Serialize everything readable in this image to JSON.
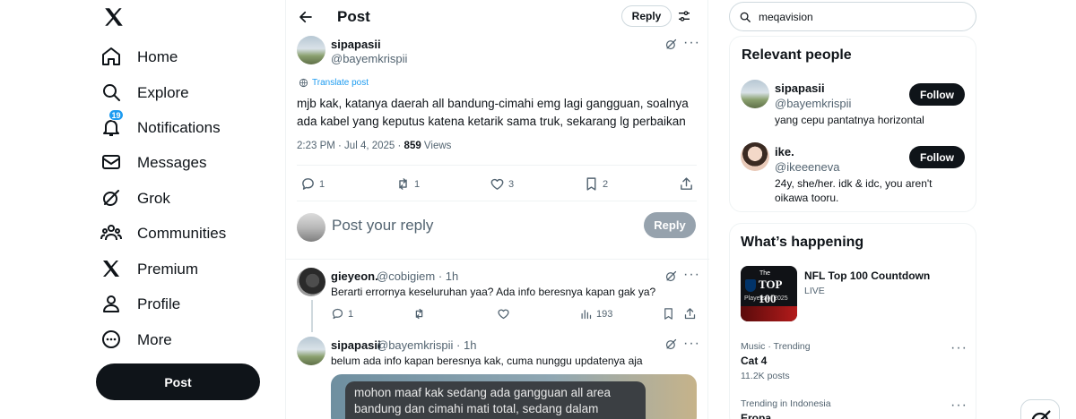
{
  "colors": {
    "accent": "#1d9bf0",
    "text": "#0f1419",
    "muted": "#536471",
    "dark_button": "#0f1419"
  },
  "nav": {
    "logo_icon": "x-logo-icon",
    "items": [
      {
        "label": "Home",
        "icon": "home-icon"
      },
      {
        "label": "Explore",
        "icon": "search-icon"
      },
      {
        "label": "Notifications",
        "icon": "bell-icon",
        "badge": "19"
      },
      {
        "label": "Messages",
        "icon": "envelope-icon"
      },
      {
        "label": "Grok",
        "icon": "grok-icon"
      },
      {
        "label": "Communities",
        "icon": "people-icon"
      },
      {
        "label": "Premium",
        "icon": "x-logo-icon"
      },
      {
        "label": "Profile",
        "icon": "person-icon"
      },
      {
        "label": "More",
        "icon": "more-circle-icon"
      }
    ],
    "post_button": "Post"
  },
  "header": {
    "title": "Post",
    "reply_pill": "Reply"
  },
  "tweet": {
    "name": "sipapasii",
    "handle": "@bayemkrispii",
    "translate": "Translate post",
    "text": "mjb kak, katanya daerah all bandung-cimahi emg lagi gangguan, soalnya ada kabel yang keputus katena ketarik sama truk, sekarang lg perbaikan",
    "time": "2:23 PM · Jul 4, 2025 · ",
    "views": "859",
    "views_label": " Views",
    "replies": "1",
    "reposts": "1",
    "likes": "3",
    "bookmarks": "2"
  },
  "compose": {
    "placeholder": "Post your reply",
    "button": "Reply"
  },
  "replies": [
    {
      "name": "gieyeon.",
      "handle": "@cobigiem · 1h",
      "text": "Berarti errornya keseluruhan yaa? Ada info beresnya kapan gak ya?",
      "replies": "1",
      "views": "193"
    },
    {
      "name": "sipapasii",
      "handle": "@bayemkrispii · 1h",
      "text": "belum ada info kapan beresnya kak, cuma nunggu updatenya aja",
      "media_text": "mohon maaf kak sedang ada gangguan all area bandung dan cimahi mati total, sedang dalam"
    }
  ],
  "sidebar": {
    "search_value": "meqavision",
    "relevant_title": "Relevant people",
    "people": [
      {
        "name": "sipapasii",
        "handle": "@bayemkrispii",
        "bio": "yang cepu pantatnya horizontal",
        "follow": "Follow"
      },
      {
        "name": "ike.",
        "handle": "@ikeeeneva",
        "bio": "24y, she/her. idk & idc, you aren't oikawa tooru.",
        "follow": "Follow"
      }
    ],
    "happening_title": "What’s happening",
    "featured": {
      "title": "NFL Top 100 Countdown",
      "status": "LIVE",
      "thumb_top": "TOP 100",
      "thumb_the": "The",
      "thumb_players": "Players of 2025"
    },
    "trends": [
      {
        "context": "Music · Trending",
        "name": "Cat 4",
        "count": "11.2K posts"
      },
      {
        "context": "Trending in Indonesia",
        "name": "Eropa",
        "count": ""
      }
    ]
  }
}
